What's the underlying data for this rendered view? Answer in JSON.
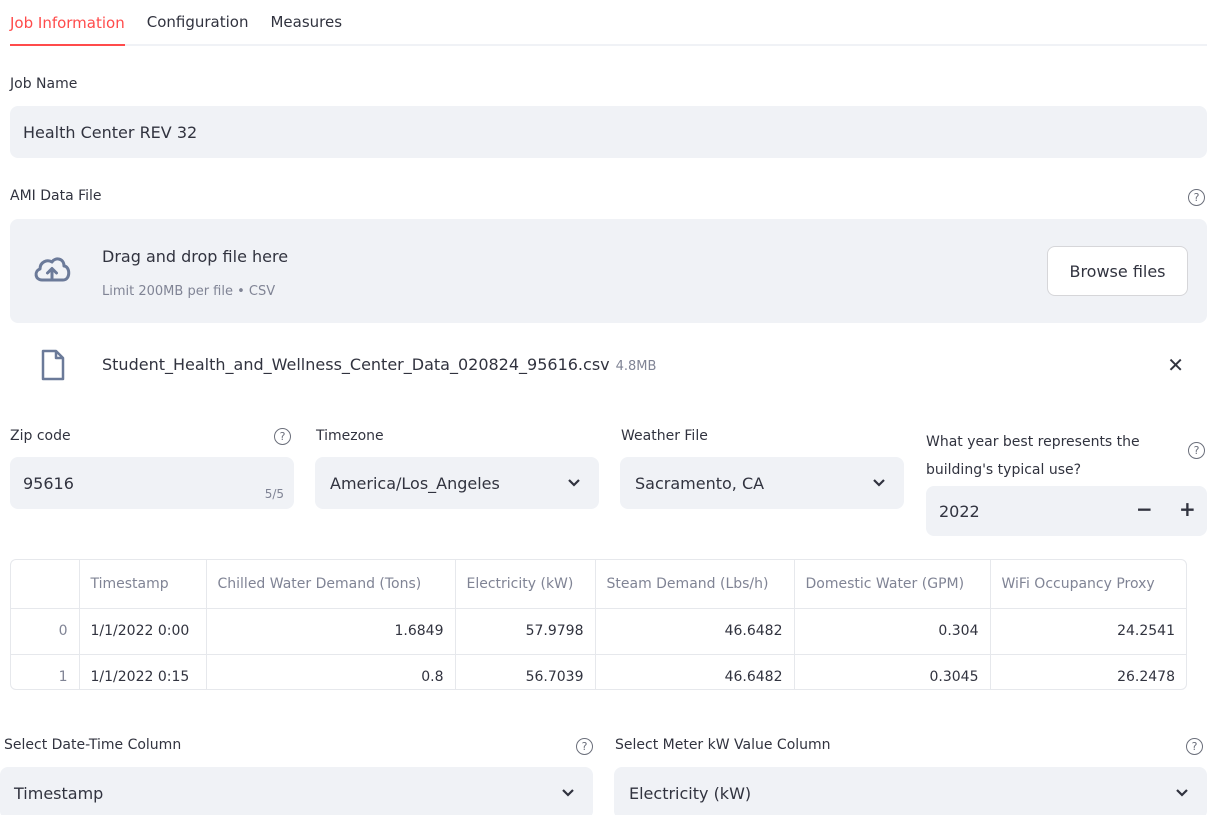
{
  "tabs": [
    {
      "label": "Job Information",
      "active": true
    },
    {
      "label": "Configuration",
      "active": false
    },
    {
      "label": "Measures",
      "active": false
    }
  ],
  "job_name": {
    "label": "Job Name",
    "value": "Health Center REV 32"
  },
  "ami": {
    "label": "AMI Data File",
    "help_icon": "question-circle-icon",
    "drop_title": "Drag and drop file here",
    "drop_sub": "Limit 200MB per file • CSV",
    "browse_label": "Browse files",
    "file_name": "Student_Health_and_Wellness_Center_Data_020824_95616.csv",
    "file_size": "4.8MB"
  },
  "zip": {
    "label": "Zip code",
    "value": "95616",
    "counter": "5/5"
  },
  "timezone": {
    "label": "Timezone",
    "value": "America/Los_Angeles"
  },
  "weather": {
    "label": "Weather File",
    "value": "Sacramento, CA"
  },
  "year": {
    "label_line1": "What year best represents the",
    "label_line2": "building's typical use?",
    "value": "2022",
    "minus": "−",
    "plus": "+"
  },
  "table": {
    "columns": [
      "",
      "Timestamp",
      "Chilled Water Demand (Tons)",
      "Electricity (kW)",
      "Steam Demand (Lbs/h)",
      "Domestic Water (GPM)",
      "WiFi Occupancy Proxy"
    ],
    "rows": [
      [
        "0",
        "1/1/2022 0:00",
        "1.6849",
        "57.9798",
        "46.6482",
        "0.304",
        "24.2541"
      ],
      [
        "1",
        "1/1/2022 0:15",
        "0.8",
        "56.7039",
        "46.6482",
        "0.3045",
        "26.2478"
      ]
    ]
  },
  "datetime_col": {
    "label": "Select Date-Time Column",
    "value": "Timestamp"
  },
  "meter_col": {
    "label": "Select Meter kW Value Column",
    "value": "Electricity (kW)"
  },
  "colors": {
    "accent": "#ff4b4b",
    "input_bg": "#f0f2f6",
    "text": "#31333f",
    "muted": "#808495"
  }
}
